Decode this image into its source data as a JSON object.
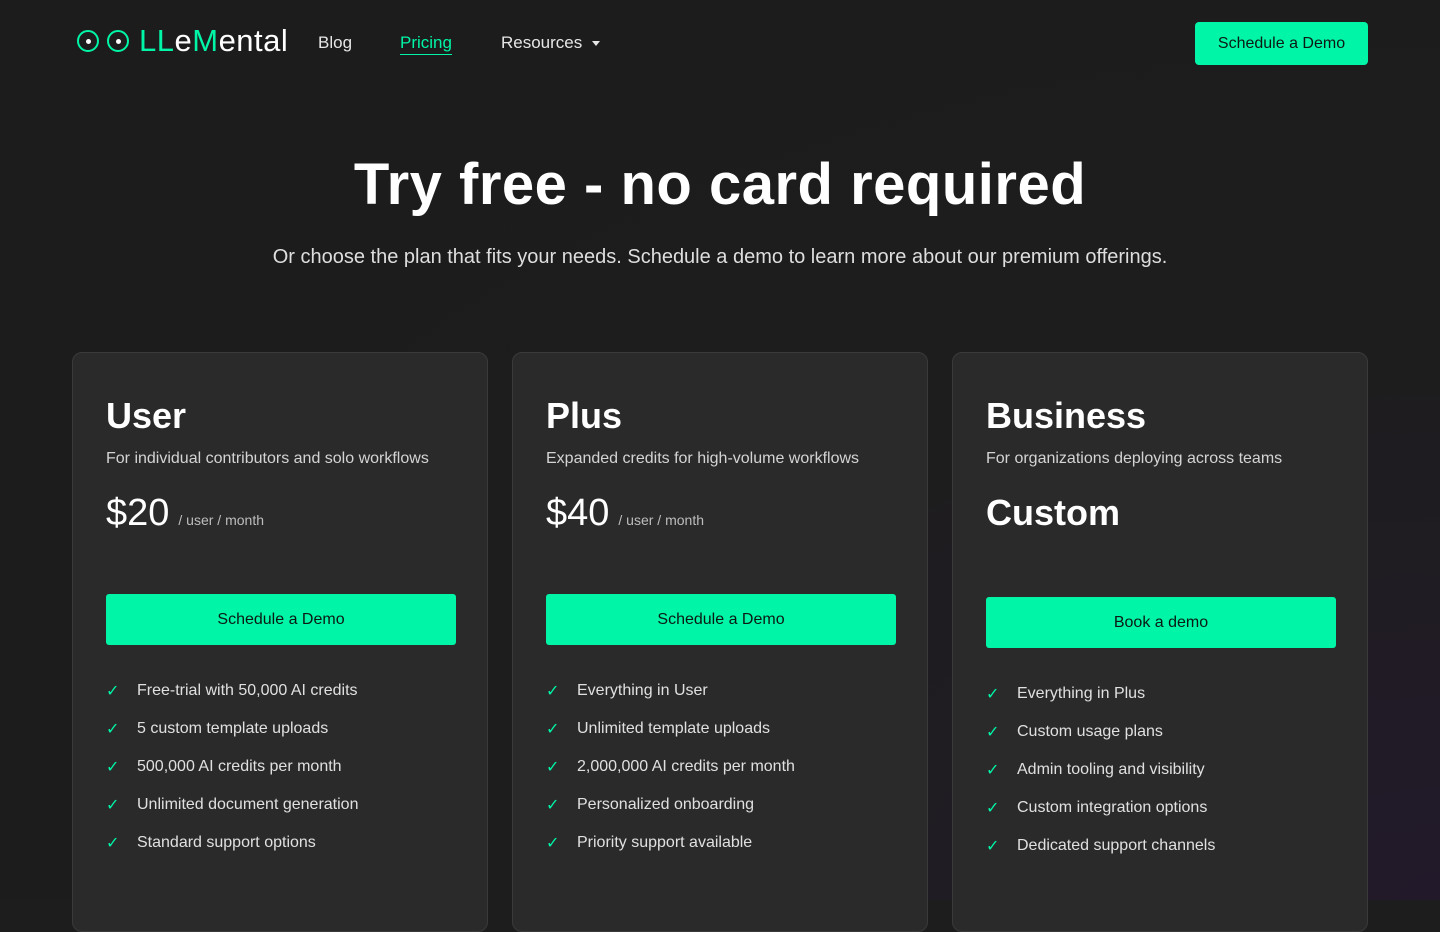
{
  "brand": {
    "name_part1": "LL",
    "name_part2": "e",
    "name_part3": "M",
    "name_part4": "ental",
    "accent_color": "#00f5a6"
  },
  "nav": {
    "links": [
      {
        "label": "Blog"
      },
      {
        "label": "Pricing",
        "active": true
      },
      {
        "label": "Resources"
      }
    ],
    "cta_label": "Schedule a Demo"
  },
  "hero": {
    "title": "Try free - no card required",
    "subtitle": "Or choose the plan that fits your needs. Schedule a demo to learn more about our premium offerings."
  },
  "plans": [
    {
      "name": "User",
      "description": "For individual contributors and solo workflows",
      "price": "$20",
      "price_unit": "/ user / month",
      "button_label": "Schedule a Demo",
      "features": [
        "Free-trial with 50,000 AI credits",
        "5 custom template uploads",
        "500,000 AI credits per month",
        "Unlimited document generation",
        "Standard support options"
      ]
    },
    {
      "name": "Plus",
      "description": "Expanded credits for high-volume workflows",
      "price": "$40",
      "price_unit": "/ user / month",
      "button_label": "Schedule a Demo",
      "features": [
        "Everything in User",
        "Unlimited template uploads",
        "2,000,000 AI credits per month",
        "Personalized onboarding",
        "Priority support available"
      ]
    },
    {
      "name": "Business",
      "description": "For organizations deploying across teams",
      "price": "Custom",
      "button_label": "Book a demo",
      "features": [
        "Everything in Plus",
        "Custom usage plans",
        "Admin tooling and visibility",
        "Custom integration options",
        "Dedicated support channels"
      ]
    }
  ],
  "icons": {
    "check": "check-icon",
    "caret": "chevron-down-icon",
    "logo": "eyes-logo-icon"
  }
}
